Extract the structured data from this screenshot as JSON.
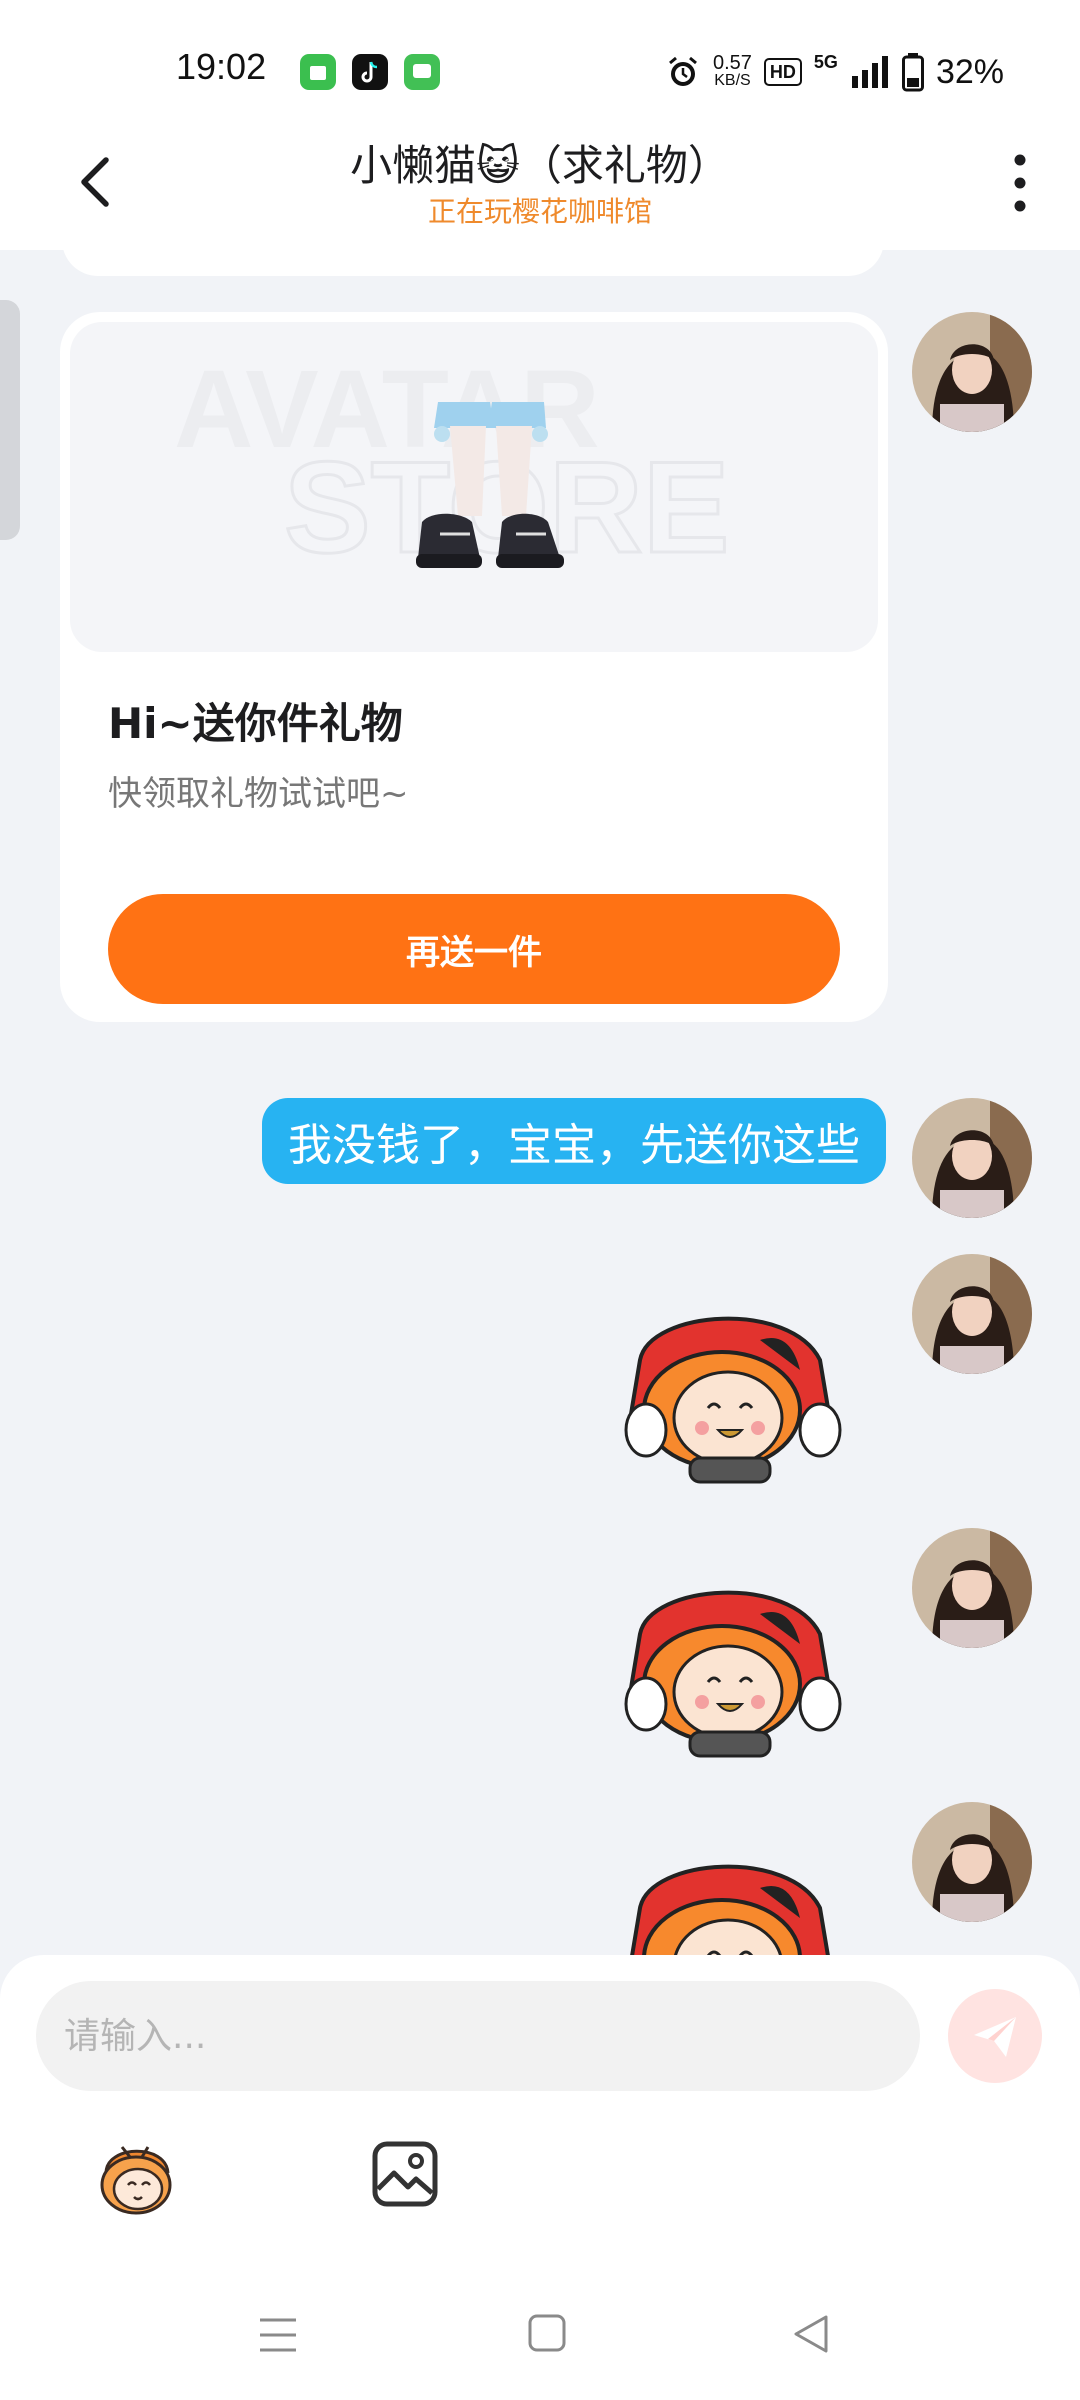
{
  "status_bar": {
    "time": "19:02",
    "net_speed_value": "0.57",
    "net_speed_unit": "KB/S",
    "hd_badge": "HD",
    "network": "5G",
    "battery": "32%"
  },
  "header": {
    "title": "小懒猫😺（求礼物）",
    "subtitle": "正在玩樱花咖啡馆"
  },
  "messages": {
    "gift_card": {
      "heading": "Hi~送你件礼物",
      "description": "快领取礼物试试吧~",
      "button_label": "再送一件",
      "watermark_line1": "AVATAR",
      "watermark_line2": "STORE"
    },
    "text_message": "我没钱了，宝宝，先送你这些"
  },
  "input": {
    "placeholder": "请输入..."
  },
  "icons": {
    "back": "back-arrow-icon",
    "more": "more-vertical-icon",
    "send": "send-icon",
    "sticker": "sticker-face-icon",
    "image": "image-icon",
    "nav_menu": "menu-icon",
    "nav_home": "home-icon",
    "nav_back": "nav-back-icon"
  },
  "colors": {
    "accent_orange": "#ff7214",
    "subtitle_orange": "#ef8a2c",
    "bubble_blue": "#27b3f2",
    "send_button": "#ffe3e1",
    "background": "#f1f3f7"
  }
}
